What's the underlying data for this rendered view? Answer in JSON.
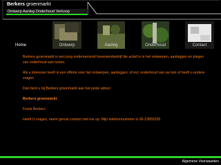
{
  "header": {
    "brand_strong": "Berkers",
    "brand_rest": " groenmarkt",
    "tagline": "Ontwerp Aanleg Onderhoud Verkoop"
  },
  "nav": {
    "items": [
      {
        "label": "Home"
      },
      {
        "label": "Ontwerp"
      },
      {
        "label": "Aanleg"
      },
      {
        "label": "Onderhoud"
      },
      {
        "label": "Contact"
      }
    ]
  },
  "content": {
    "p1": "Berkers groenmarkt is een jong ondernemend hoveniersbedrijf die actief is in het ontwerpen, aanleggen en plegen van onderhoud aan tuinen.",
    "p2": "Als u interesse heeft in een offerte voor het ontwerpen, aanleggen, of evt. onderhoud van uw tuin of heeft u andere vragen",
    "p3": "Dan bent u bij Berkers groenmarkt aan het juiste adres!",
    "p4": "Berkers groenmarkt",
    "p5": "Frank Berkers",
    "p6": "Heeft U vragen, neem gerust contact met me op. Mijn telefoonnummer is 06-23855335"
  },
  "footer": {
    "text": "Algemene Voorwaarden"
  },
  "colors": {
    "accent_green": "#2bd52b",
    "text_orange": "#ff7c1a",
    "background": "#000000"
  }
}
